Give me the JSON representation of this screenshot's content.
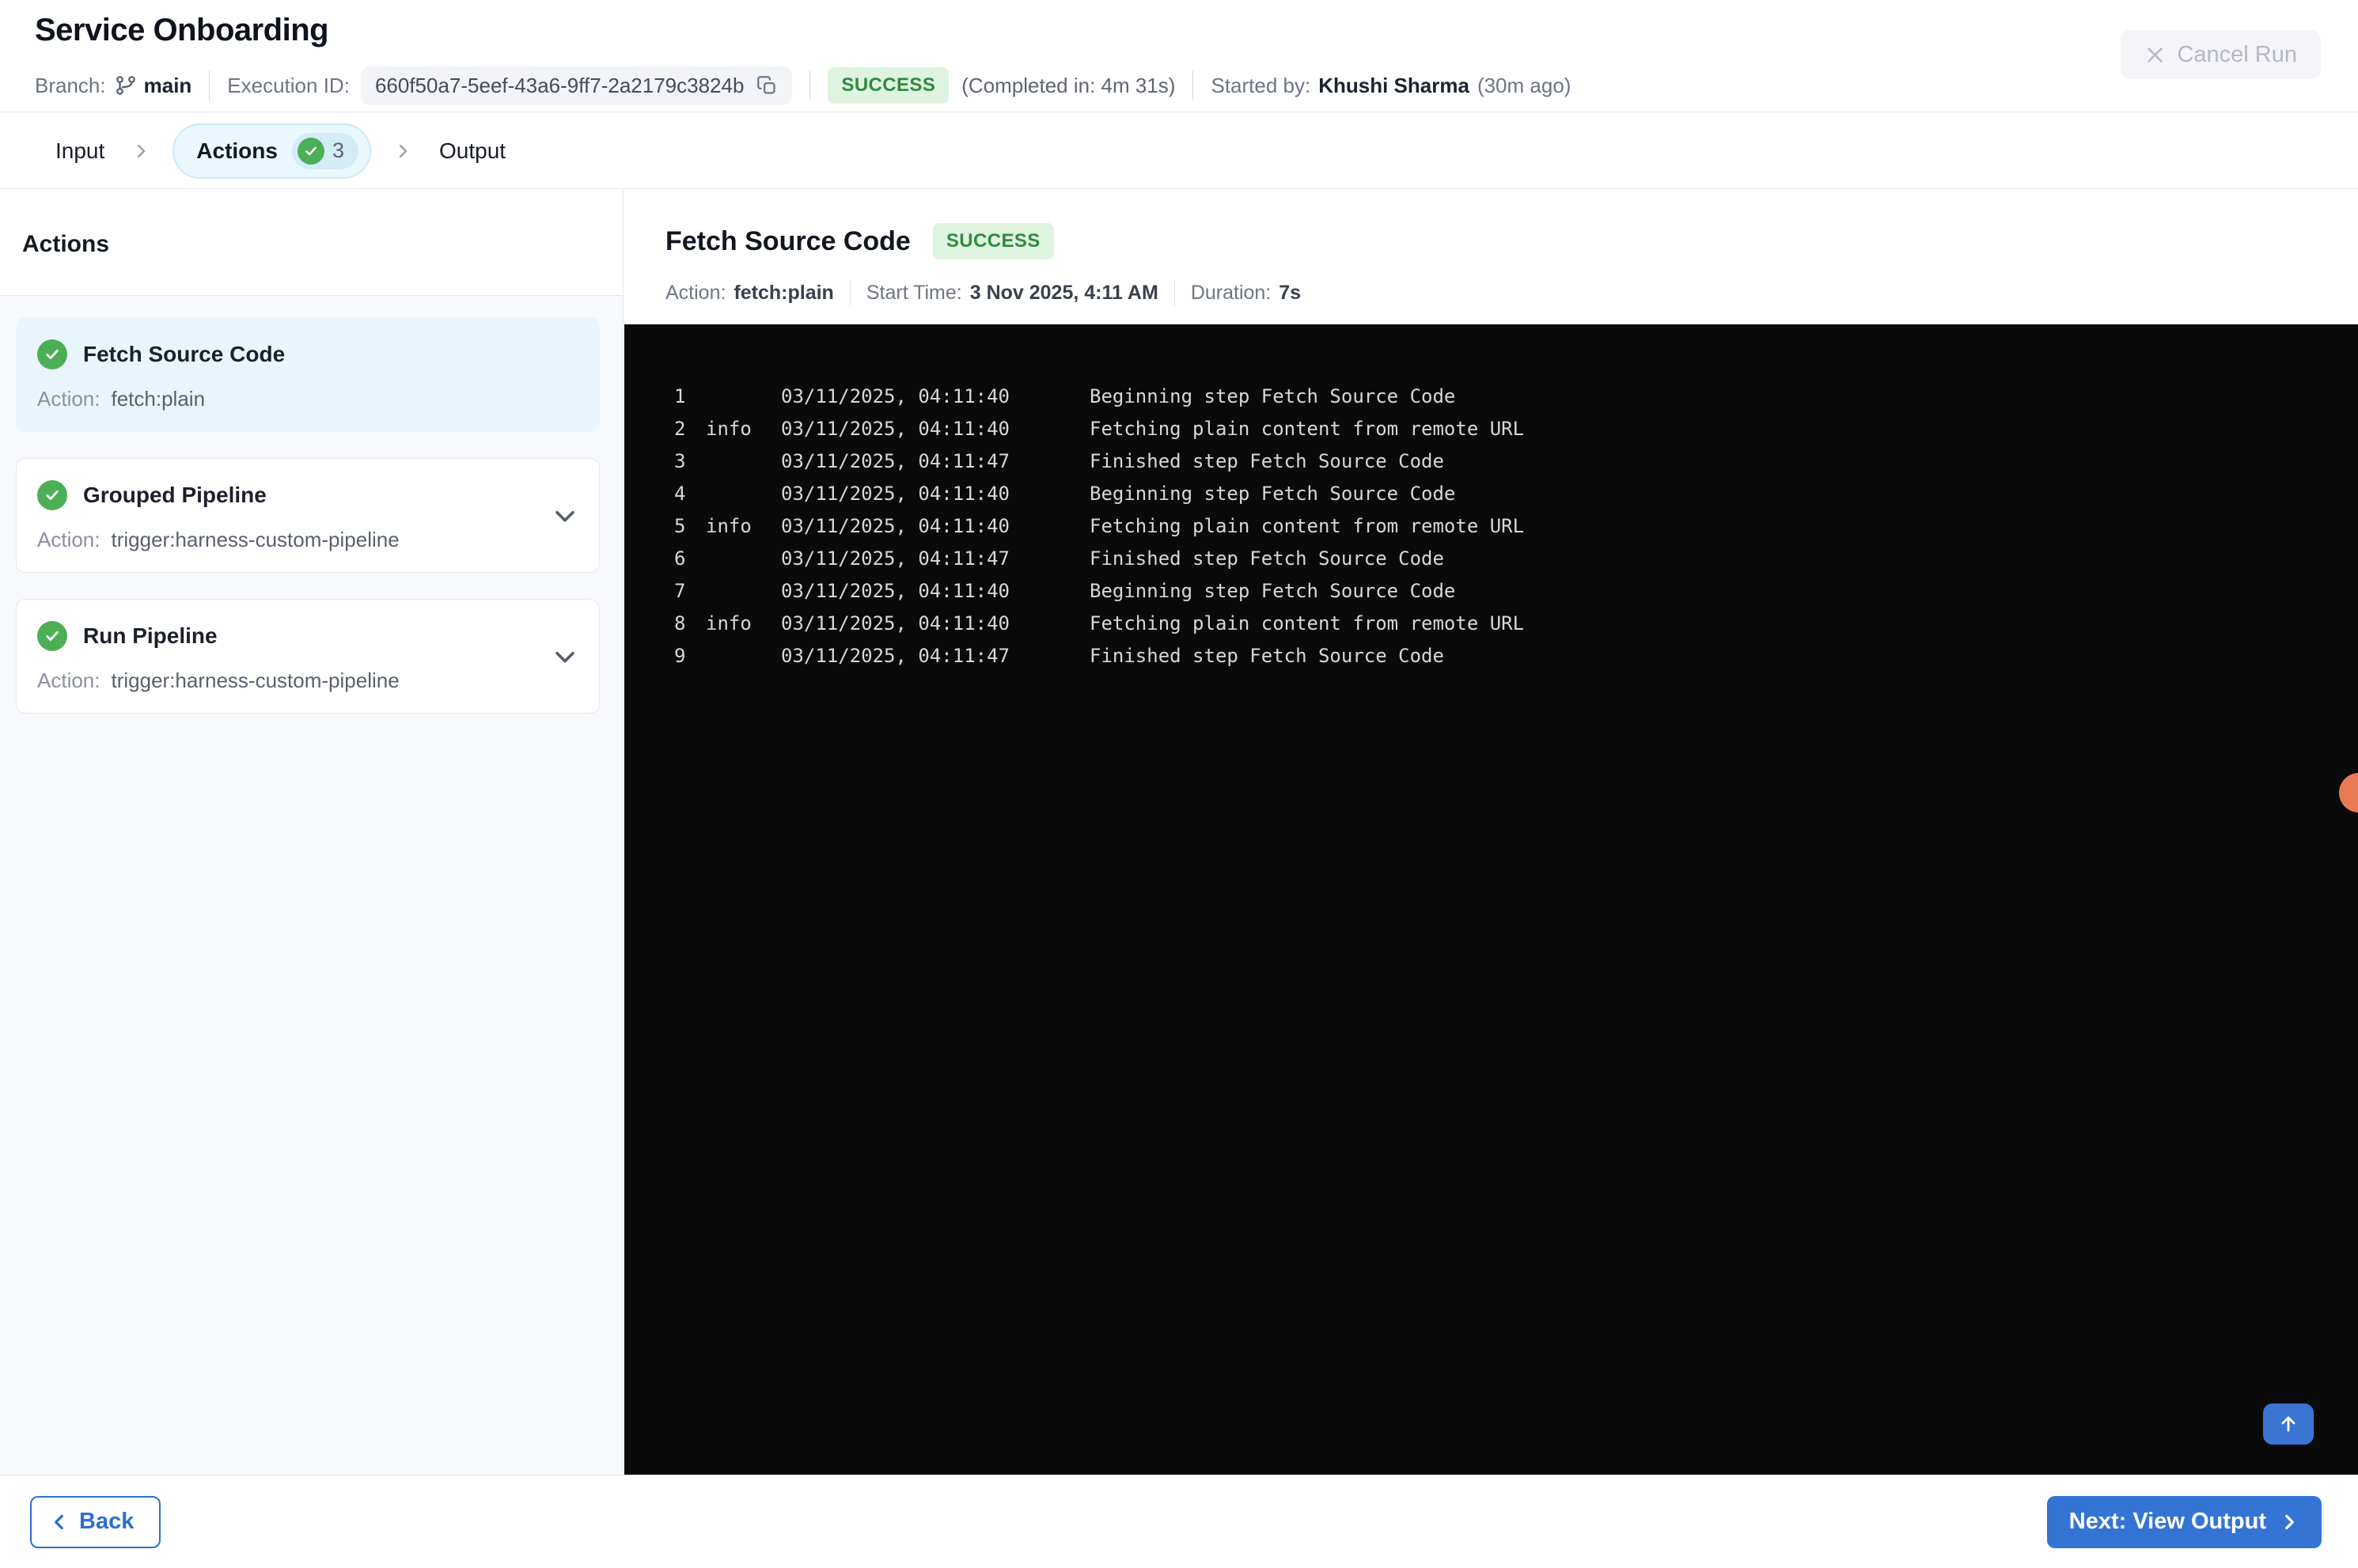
{
  "header": {
    "title": "Service Onboarding",
    "branch_label": "Branch:",
    "branch": "main",
    "execution_id_label": "Execution ID:",
    "execution_id": "660f50a7-5eef-43a6-9ff7-2a2179c3824b",
    "status": "SUCCESS",
    "completed_in": "(Completed in: 4m 31s)",
    "started_by_label": "Started by:",
    "started_by": "Khushi Sharma",
    "started_ago": "(30m ago)",
    "cancel_label": "Cancel Run"
  },
  "tabs": {
    "input": "Input",
    "actions": "Actions",
    "actions_count": "3",
    "output": "Output",
    "active": "Actions"
  },
  "sidebar": {
    "heading": "Actions",
    "items": [
      {
        "title": "Fetch Source Code",
        "action_label": "Action:",
        "action": "fetch:plain",
        "status": "success",
        "selected": true,
        "expandable": false
      },
      {
        "title": "Grouped Pipeline",
        "action_label": "Action:",
        "action": "trigger:harness-custom-pipeline",
        "status": "success",
        "selected": false,
        "expandable": true
      },
      {
        "title": "Run Pipeline",
        "action_label": "Action:",
        "action": "trigger:harness-custom-pipeline",
        "status": "success",
        "selected": false,
        "expandable": true
      }
    ]
  },
  "detail": {
    "title": "Fetch Source Code",
    "status": "SUCCESS",
    "action_label": "Action:",
    "action": "fetch:plain",
    "start_label": "Start Time:",
    "start": "3 Nov 2025, 4:11 AM",
    "duration_label": "Duration:",
    "duration": "7s"
  },
  "console": {
    "lines": [
      {
        "num": "1",
        "level": "",
        "time": "03/11/2025, 04:11:40",
        "msg": "Beginning step Fetch Source Code"
      },
      {
        "num": "2",
        "level": "info",
        "time": "03/11/2025, 04:11:40",
        "msg": "Fetching plain content from remote URL"
      },
      {
        "num": "3",
        "level": "",
        "time": "03/11/2025, 04:11:47",
        "msg": "Finished step Fetch Source Code"
      },
      {
        "num": "4",
        "level": "",
        "time": "03/11/2025, 04:11:40",
        "msg": "Beginning step Fetch Source Code"
      },
      {
        "num": "5",
        "level": "info",
        "time": "03/11/2025, 04:11:40",
        "msg": "Fetching plain content from remote URL"
      },
      {
        "num": "6",
        "level": "",
        "time": "03/11/2025, 04:11:47",
        "msg": "Finished step Fetch Source Code"
      },
      {
        "num": "7",
        "level": "",
        "time": "03/11/2025, 04:11:40",
        "msg": "Beginning step Fetch Source Code"
      },
      {
        "num": "8",
        "level": "info",
        "time": "03/11/2025, 04:11:40",
        "msg": "Fetching plain content from remote URL"
      },
      {
        "num": "9",
        "level": "",
        "time": "03/11/2025, 04:11:47",
        "msg": "Finished step Fetch Source Code"
      }
    ]
  },
  "footer": {
    "back_label": "Back",
    "next_label": "Next: View Output"
  },
  "colors": {
    "accent_blue": "#3474d4",
    "success_check_green": "#4cae55",
    "success_badge_bg": "#dff3e1",
    "success_badge_text": "#2e8b3d",
    "selected_card_bg": "#e8f5fd",
    "active_tab_bg": "#eaf8fe",
    "console_bg": "#0a0a0b",
    "helper_dot_orange": "#e87a55"
  }
}
